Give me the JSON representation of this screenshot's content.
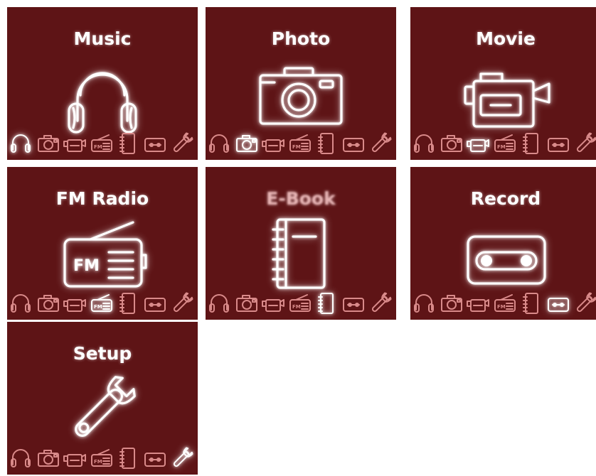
{
  "screens": [
    {
      "id": "music",
      "title": "Music",
      "icon": "headphones-icon",
      "selected_index": 0
    },
    {
      "id": "photo",
      "title": "Photo",
      "icon": "camera-icon",
      "selected_index": 1
    },
    {
      "id": "movie",
      "title": "Movie",
      "icon": "video-camera-icon",
      "selected_index": 2
    },
    {
      "id": "fm-radio",
      "title": "FM Radio",
      "icon": "radio-icon",
      "selected_index": 3
    },
    {
      "id": "e-book",
      "title": "E-Book",
      "icon": "notebook-icon",
      "selected_index": 4
    },
    {
      "id": "record",
      "title": "Record",
      "icon": "cassette-icon",
      "selected_index": 5
    },
    {
      "id": "setup",
      "title": "Setup",
      "icon": "wrench-icon",
      "selected_index": 6
    }
  ],
  "icon_strip": [
    "headphones-icon",
    "camera-icon",
    "video-camera-icon",
    "radio-icon",
    "notebook-icon",
    "cassette-icon",
    "wrench-icon"
  ],
  "radio_badge": "FM",
  "colors": {
    "background": "#5e1416",
    "icon_dim": "#d98a8a",
    "icon_active": "#ffffff"
  }
}
